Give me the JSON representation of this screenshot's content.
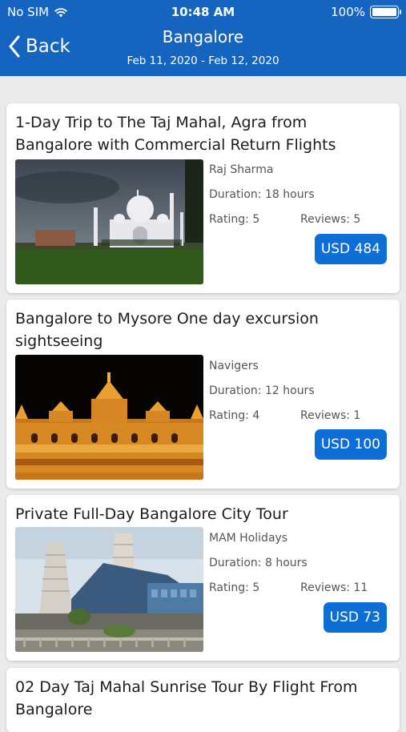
{
  "status_bar": {
    "carrier": "No SIM",
    "time": "10:48 AM",
    "battery": "100%"
  },
  "header": {
    "back_label": "Back",
    "title": "Bangalore",
    "date_range": "Feb 11, 2020 - Feb 12, 2020"
  },
  "tours": [
    {
      "title": "1-Day Trip to The Taj Mahal, Agra from Bangalore with Commercial Return Flights",
      "operator": "Raj Sharma",
      "duration_label": "Duration:",
      "duration": "18 hours",
      "rating_label": "Rating:",
      "rating": "5",
      "reviews_label": "Reviews:",
      "reviews": "5",
      "price": "USD 484"
    },
    {
      "title": "Bangalore to Mysore One day excursion sightseeing",
      "operator": "Navigers",
      "duration_label": "Duration:",
      "duration": "12 hours",
      "rating_label": "Rating:",
      "rating": "4",
      "reviews_label": "Reviews:",
      "reviews": "1",
      "price": "USD 100"
    },
    {
      "title": "Private Full-Day Bangalore City Tour",
      "operator": "MAM Holidays",
      "duration_label": "Duration:",
      "duration": "8 hours",
      "rating_label": "Rating:",
      "rating": "5",
      "reviews_label": "Reviews:",
      "reviews": "11",
      "price": "USD 73"
    },
    {
      "title": "02 Day Taj Mahal Sunrise Tour By Flight From Bangalore"
    }
  ],
  "colors": {
    "header": "#1565c0",
    "price_button": "#0d6ed6",
    "background": "#ebebeb"
  }
}
